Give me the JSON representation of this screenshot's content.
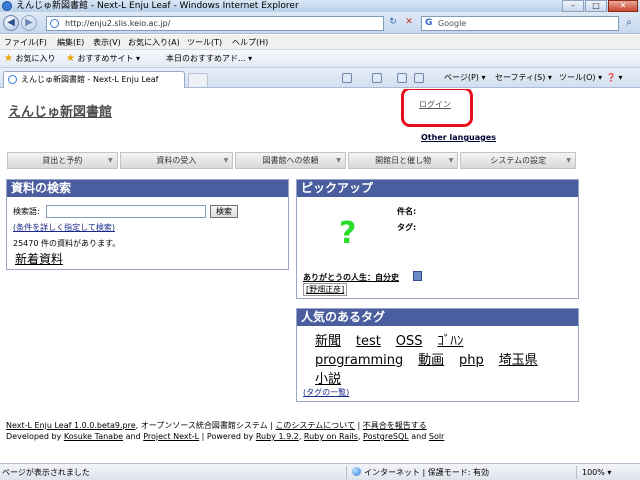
{
  "window": {
    "title": "えんじゅ新図書館 - Next-L Enju Leaf - Windows Internet Explorer",
    "minimize": "–",
    "maximize": "□",
    "close": "✕"
  },
  "address": {
    "url": "http://enju2.slis.keio.ac.jp/",
    "refresh": "↻",
    "stop": "✕",
    "search_label": "Google",
    "search_icon": "⌕"
  },
  "menubar": {
    "items": [
      "ファイル(F)",
      "編集(E)",
      "表示(V)",
      "お気に入り(A)",
      "ツール(T)",
      "ヘルプ(H)"
    ]
  },
  "favbar": {
    "favorites": "お気に入り",
    "suggested": "おすすめサイト ▾",
    "webslice": "本日のおすすめアド... ▾"
  },
  "tabbar": {
    "tab_label": "えんじゅ新図書館 - Next-L Enju Leaf",
    "page": "ページ(P) ▾",
    "safety": "セーフティ(S) ▾",
    "tools": "ツール(O) ▾",
    "help": "❓ ▾"
  },
  "site": {
    "title": "えんじゅ新図書館",
    "login": "ログイン",
    "other_languages": "Other languages",
    "nav": [
      "貸出と予約",
      "資料の受入",
      "図書館への依頼",
      "開館日と催し物",
      "システムの設定"
    ]
  },
  "search": {
    "heading": "資料の検索",
    "label": "検索語:",
    "button": "検索",
    "advanced_link": "(条件を詳しく指定して検索)",
    "count_text": "25470 件の資料があります。",
    "new_items": "新着資料"
  },
  "pickup": {
    "heading": "ピックアップ",
    "placeholder": "?",
    "title_label": "件名:",
    "tag_label": "タグ:",
    "book_title": "ありがとうの人生：自分史",
    "book_author": "[野畑正彦]"
  },
  "tags": {
    "heading": "人気のあるタグ",
    "items": [
      "新聞",
      "test",
      "OSS",
      "ｺﾞﾊﾝ",
      "programming",
      "動画",
      "php",
      "埼玉県",
      "小説"
    ],
    "list_link": "(タグの一覧)"
  },
  "footer": {
    "enju_link": "Next-L Enju Leaf 1.0.0.beta9.pre",
    "description": ", オープンソース統合図書館システム | ",
    "about_link": "このシステムについて",
    "sep1": " | ",
    "report_link": "不具合を報告する",
    "developed_by": "Developed by ",
    "author1": "Kosuke Tanabe",
    "and": " and ",
    "author2": "Project Next-L",
    "powered": " | Powered by ",
    "ruby": "Ruby 1.9.2",
    "comma1": ", ",
    "rails": "Ruby on Rails",
    "comma2": ", ",
    "postgres": "PostgreSQL",
    "and2": " and ",
    "solr": "Solr"
  },
  "status": {
    "text": "ページが表示されました",
    "zone": "インターネット | 保護モード: 有効",
    "zoom": "100% ▾"
  }
}
